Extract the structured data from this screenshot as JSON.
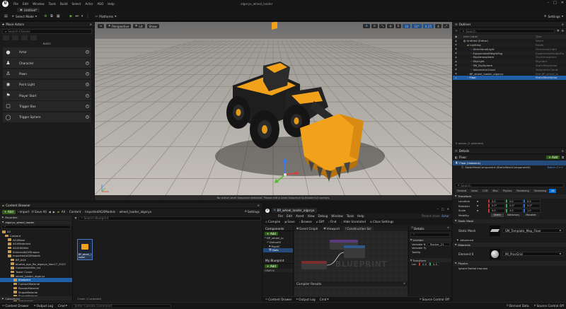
{
  "window": {
    "title": "algoryx_wheel_loader",
    "map_tab": "Untitled*",
    "menus": [
      "File",
      "Edit",
      "Window",
      "Tools",
      "Build",
      "Select",
      "Actor",
      "ASO",
      "Help"
    ]
  },
  "toolbar": {
    "select_mode": "Select Mode",
    "platforms": "Platforms",
    "settings": "Settings"
  },
  "place_actors": {
    "tab": "Place Actors",
    "search_placeholder": "Search Classes",
    "category": "BASIC",
    "items": [
      {
        "label": "Actor",
        "icon": "sphere-icon"
      },
      {
        "label": "Character",
        "icon": "character-icon"
      },
      {
        "label": "Pawn",
        "icon": "pawn-icon"
      },
      {
        "label": "Point Light",
        "icon": "point-light-icon"
      },
      {
        "label": "Player Start",
        "icon": "player-start-icon"
      },
      {
        "label": "Trigger Box",
        "icon": "trigger-box-icon"
      },
      {
        "label": "Trigger Sphere",
        "icon": "trigger-sphere-icon"
      }
    ]
  },
  "viewport": {
    "perspective": "Perspective",
    "lit": "Lit",
    "show": "Show",
    "grid_value": "10",
    "angle_value": "10°",
    "scale_value": "0.25",
    "camera_value": "4",
    "sequence_msg": "No active Level Sequence detected. Please edit a Level Sequence to enable full controls."
  },
  "outliner": {
    "tab": "Outliner",
    "search_placeholder": "Search",
    "col_label": "Item Label",
    "col_type": "Type",
    "rows": [
      {
        "label": "Untitled (Editor)",
        "type": "World",
        "indent": 0
      },
      {
        "label": "Lighting",
        "type": "Folder",
        "indent": 1
      },
      {
        "label": "DirectionalLight",
        "type": "DirectionalLight",
        "indent": 2
      },
      {
        "label": "ExponentialHeightFog",
        "type": "ExponentialHeightFog",
        "indent": 2
      },
      {
        "label": "SkyAtmosphere",
        "type": "SkyAtmosphere",
        "indent": 2
      },
      {
        "label": "SkyLight",
        "type": "SkyLight",
        "indent": 2
      },
      {
        "label": "SM_SkySphere",
        "type": "StaticMeshActor",
        "indent": 2
      },
      {
        "label": "VolumetricCloud",
        "type": "VolumetricCloud",
        "indent": 2
      },
      {
        "label": "BP_wheel_loader_algoryx",
        "type": "Edit BP_wheel_lo",
        "indent": 1
      },
      {
        "label": "Floor",
        "type": "StaticMeshActor",
        "indent": 1
      }
    ],
    "footer": "9 actors (1 selected)"
  },
  "details": {
    "tab": "Details",
    "object": "Floor",
    "add": "+ Add",
    "instance": "Floor (Instance)",
    "component": "StaticMeshComponent (StaticMeshComponent0)",
    "component_edit": "Edit in C++",
    "search_placeholder": "Search",
    "filters": [
      "General",
      "Actor",
      "LOD",
      "Misc",
      "Physics",
      "Rendering",
      "Streaming",
      "All"
    ],
    "transform_label": "Transform",
    "location": {
      "label": "Location",
      "x": "0.0",
      "y": "0.0",
      "z": "0.0"
    },
    "rotation": {
      "label": "Rotation",
      "x": "0.0°",
      "y": "0.0°",
      "z": "0.0°"
    },
    "scale": {
      "label": "Scale",
      "x": "4.0",
      "y": "4.0",
      "z": "1.0"
    },
    "mobility": {
      "label": "Mobility",
      "options": [
        "Static",
        "Stationary",
        "Movable"
      ]
    },
    "static_mesh_section": "Static Mesh",
    "static_mesh_label": "Static Mesh",
    "static_mesh_value": "SM_Template_Map_Floor",
    "advanced": "Advanced",
    "materials_section": "Materials",
    "element_label": "Element 0",
    "element_value": "MI_ProcGrid",
    "physics_section": "Physics",
    "physics_row": "Ignore Radial Impulse"
  },
  "content_browser": {
    "tab": "Content Browser",
    "add": "+ Add",
    "import": "Import",
    "save_all": "Save All",
    "breadcrumb": [
      "All",
      "Content",
      "ImportedAGXModels",
      "wheel_loader_algoryx"
    ],
    "settings": "Settings",
    "favorites": "Favorites",
    "project": "algoryx_wheel_loader",
    "tree": [
      {
        "label": "All",
        "indent": 0
      },
      {
        "label": "Content",
        "indent": 1
      },
      {
        "label": "AGXBase",
        "indent": 2
      },
      {
        "label": "AGXMaterials",
        "indent": 2
      },
      {
        "label": "AGXUtilities",
        "indent": 2
      },
      {
        "label": "ExternalAGXShapes",
        "indent": 2
      },
      {
        "label": "ImportedAGXModels",
        "indent": 2
      },
      {
        "label": "BP_AGX",
        "indent": 3
      },
      {
        "label": "bluetst_agx_Bo_algoryx_Nov17_2023",
        "indent": 3
      },
      {
        "label": "ConstraintsMin_tst",
        "indent": 3
      },
      {
        "label": "Tower Crane",
        "indent": 3
      },
      {
        "label": "wheel_loader_algoryx",
        "indent": 3
      },
      {
        "label": "Blueprint",
        "indent": 4,
        "selected": true
      },
      {
        "label": "ContactMaterial",
        "indent": 4
      },
      {
        "label": "RenderMaterial",
        "indent": 4
      },
      {
        "label": "ShapeMaterial",
        "indent": 4
      },
      {
        "label": "ShapeMaterial",
        "indent": 4
      },
      {
        "label": "StaticMesh",
        "indent": 4
      },
      {
        "label": "wheel_loader_algoryx",
        "indent": 2
      }
    ],
    "search_placeholder": "Search Blueprint",
    "asset_label": "BP_wheel_loader",
    "item_count": "1 item (1 selected)",
    "collections": "Collections"
  },
  "blueprint": {
    "tab": "BP_wheel_loader_algoryx",
    "menus": [
      "File",
      "Edit",
      "Asset",
      "View",
      "Debug",
      "Window",
      "Tools",
      "Help"
    ],
    "parent": "Actor",
    "buttons": [
      "Compile",
      "Save",
      "Browse",
      "Diff",
      "Find",
      "Hide Unrelated",
      "Class Settings"
    ],
    "components_tab": "Components",
    "event_graph": "Event Graph",
    "viewport_tab": "Viewport",
    "construction_tab": "Construction Scr",
    "details_tab": "Details",
    "add": "+ Add",
    "root": "BP_wheel_lo",
    "default_scene": "DefaultS",
    "rigid": "RigidC",
    "constraint": "Dofs",
    "my_blueprint": "My Blueprint",
    "graphs": "GRAPHS",
    "watermark": "BLUEPRINT",
    "compiler_results": "Compiler Results",
    "variable_section": "Variable",
    "variable_name_label": "Variable N",
    "variable_name_value": "Rocker_21",
    "variable_type_label": "Variable Ty",
    "tooltip_label": "Tooltip",
    "transform_section": "Transform",
    "location_label": "Loc",
    "location_value": "0.0",
    "source_control": "Source Control Off"
  },
  "status_bar": {
    "content_drawer": "Content Drawer",
    "output_log": "Output Log",
    "cmd": "Cmd",
    "console_placeholder": "Enter Console Command",
    "bp_output_log": "Output Log",
    "bp_cmd": "Cmd",
    "derived_data": "Derived Data",
    "source_control": "Source Control Off"
  },
  "colors": {
    "accent_blue": "#0070e0",
    "green_play": "#4fba2a",
    "yellow_machine": "#f2a11b"
  }
}
